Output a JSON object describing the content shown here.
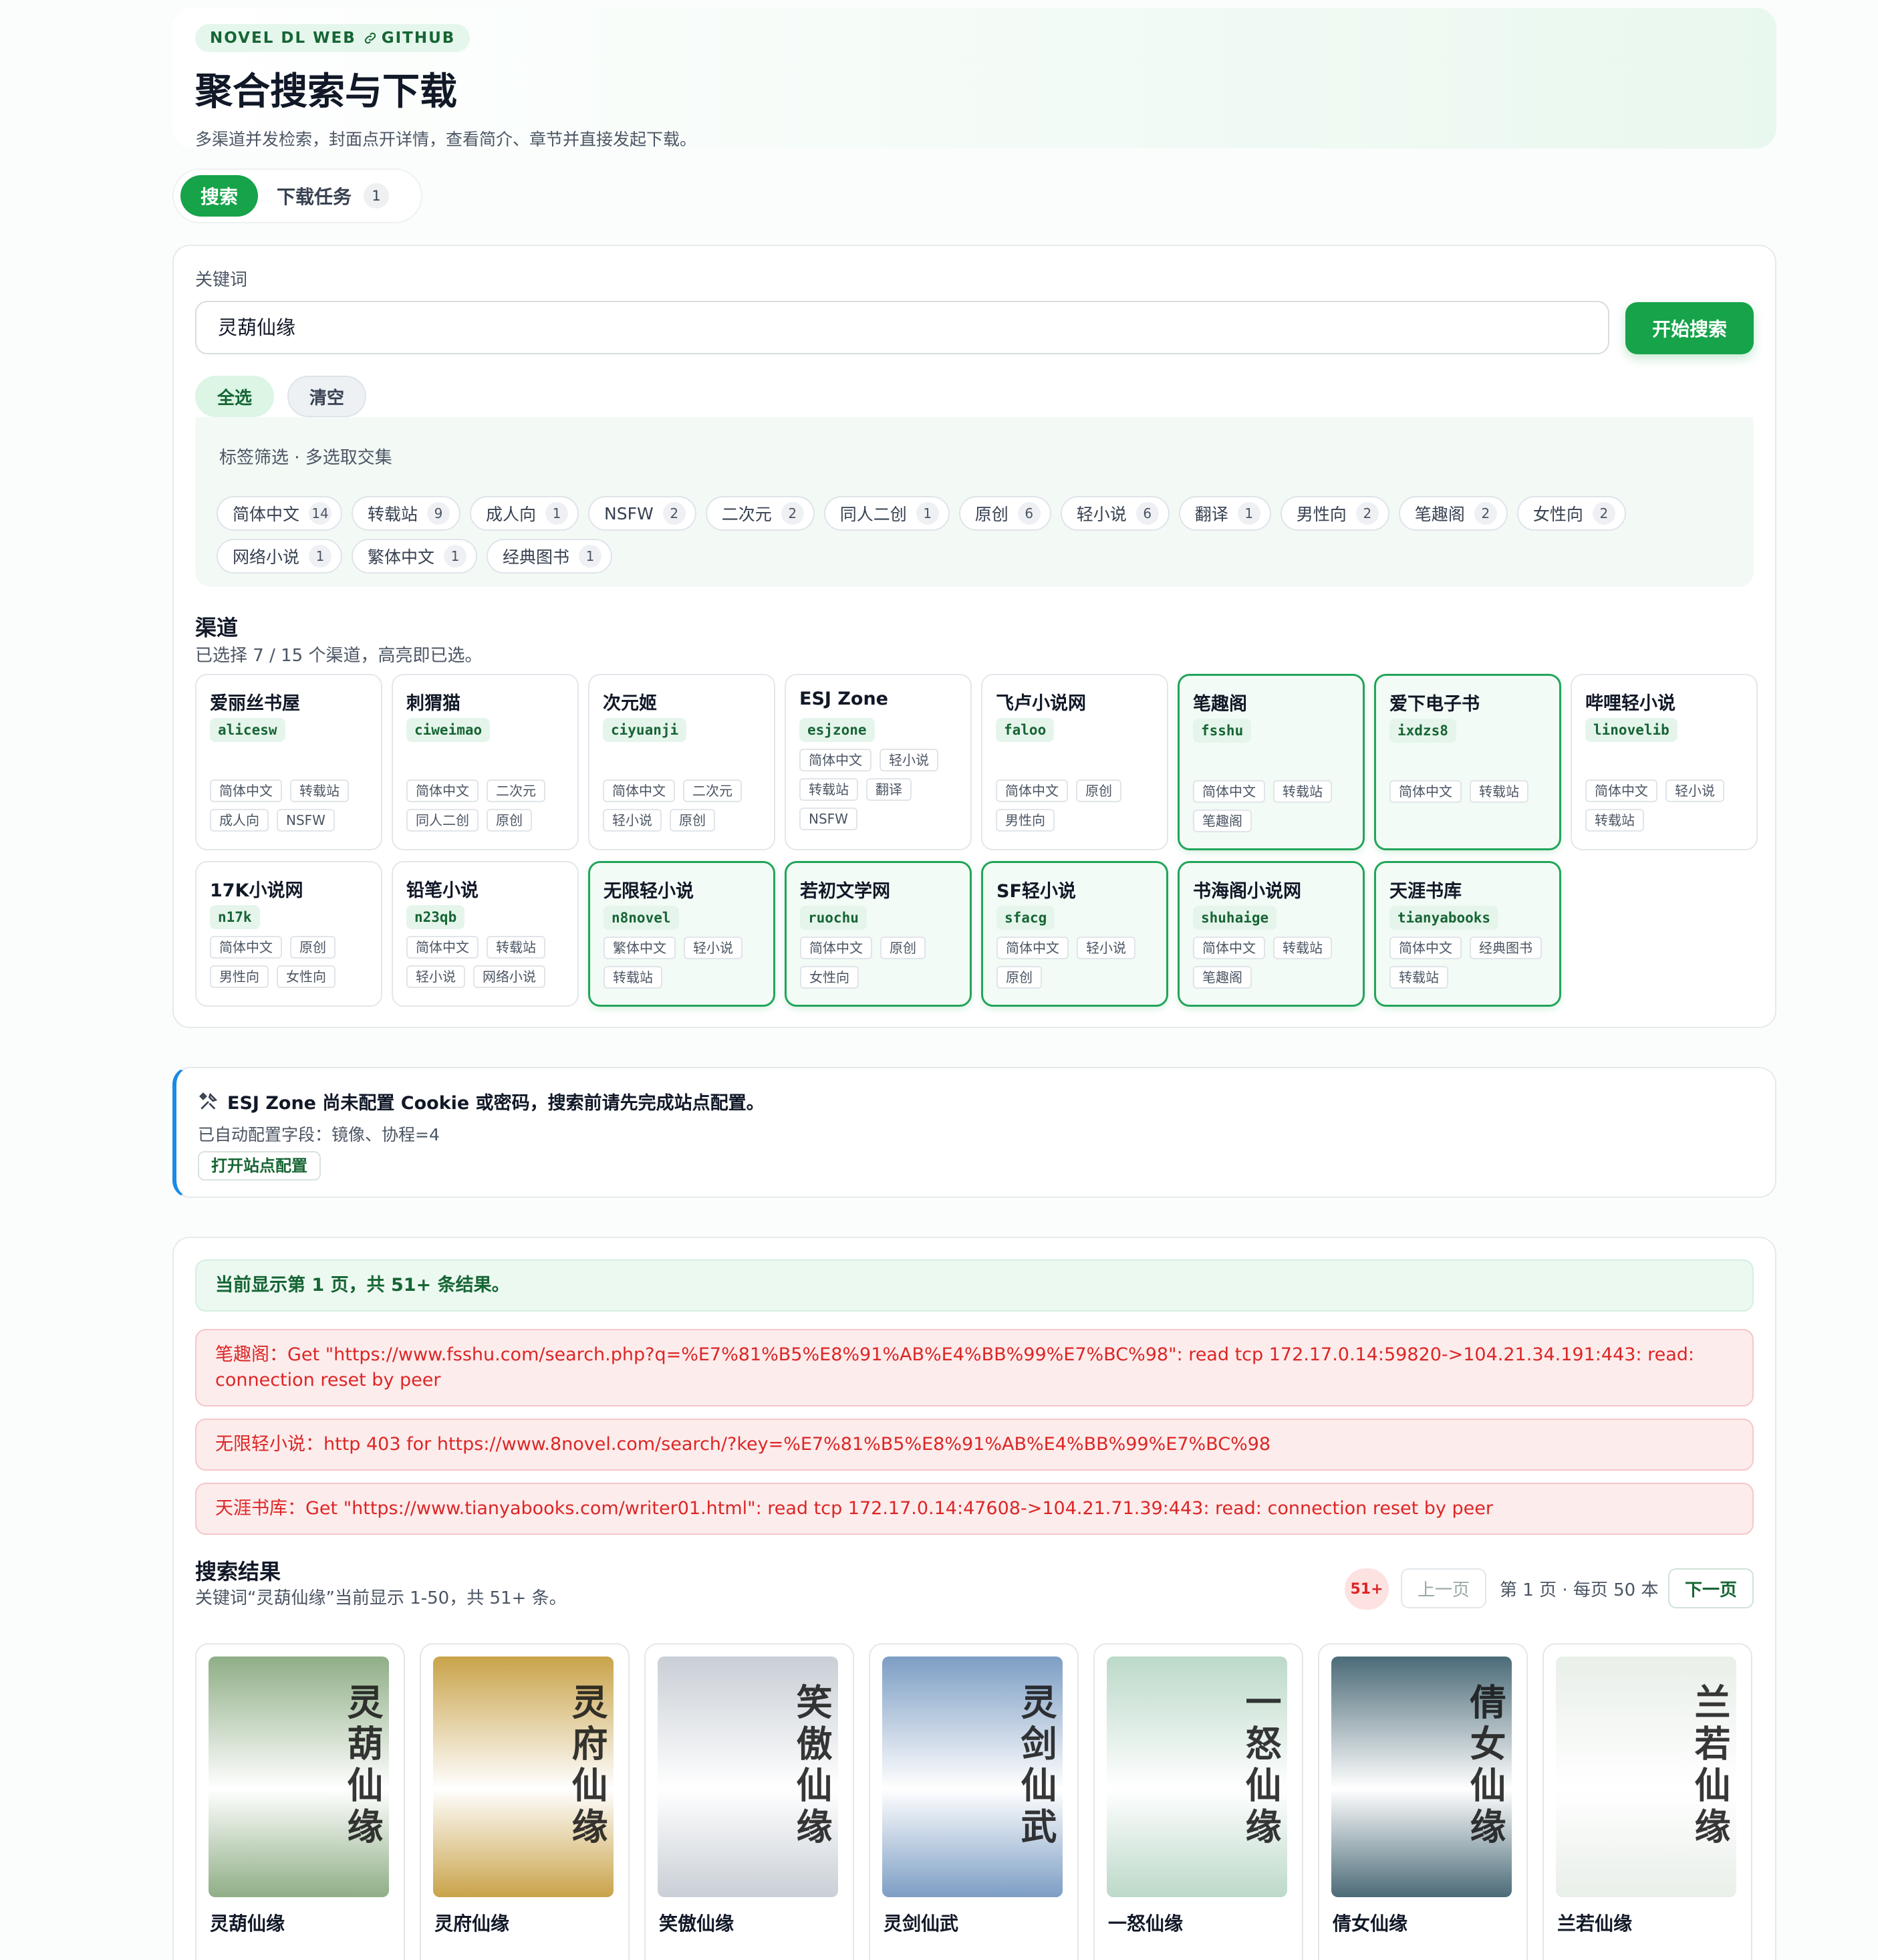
{
  "header": {
    "badge": "NOVEL DL WEB",
    "github_label": "GITHUB",
    "title": "聚合搜索与下载",
    "subtitle": "多渠道并发检索，封面点开详情，查看简介、章节并直接发起下载。"
  },
  "tabs": {
    "search": "搜索",
    "downloads": "下载任务",
    "downloads_count": "1"
  },
  "search": {
    "keyword_label": "关键词",
    "keyword_value": "灵葫仙缘",
    "submit_label": "开始搜索",
    "select_all": "全选",
    "clear": "清空",
    "tag_filter_title": "标签筛选 · 多选取交集",
    "tags": [
      {
        "name": "简体中文",
        "count": "14"
      },
      {
        "name": "转载站",
        "count": "9"
      },
      {
        "name": "成人向",
        "count": "1"
      },
      {
        "name": "NSFW",
        "count": "2"
      },
      {
        "name": "二次元",
        "count": "2"
      },
      {
        "name": "同人二创",
        "count": "1"
      },
      {
        "name": "原创",
        "count": "6"
      },
      {
        "name": "轻小说",
        "count": "6"
      },
      {
        "name": "翻译",
        "count": "1"
      },
      {
        "name": "男性向",
        "count": "2"
      },
      {
        "name": "笔趣阁",
        "count": "2"
      },
      {
        "name": "女性向",
        "count": "2"
      },
      {
        "name": "网络小说",
        "count": "1"
      },
      {
        "name": "繁体中文",
        "count": "1"
      },
      {
        "name": "经典图书",
        "count": "1"
      }
    ]
  },
  "channels": {
    "title": "渠道",
    "summary": "已选择 7 / 15 个渠道，高亮即已选。",
    "items": [
      {
        "name": "爱丽丝书屋",
        "code": "alicesw",
        "selected": false,
        "tags": [
          "简体中文",
          "转载站",
          "成人向",
          "NSFW"
        ]
      },
      {
        "name": "刺猬猫",
        "code": "ciweimao",
        "selected": false,
        "tags": [
          "简体中文",
          "二次元",
          "同人二创",
          "原创"
        ]
      },
      {
        "name": "次元姬",
        "code": "ciyuanji",
        "selected": false,
        "tags": [
          "简体中文",
          "二次元",
          "轻小说",
          "原创"
        ]
      },
      {
        "name": "ESJ Zone",
        "code": "esjzone",
        "selected": false,
        "tags": [
          "简体中文",
          "轻小说",
          "转载站",
          "翻译",
          "NSFW"
        ]
      },
      {
        "name": "飞卢小说网",
        "code": "faloo",
        "selected": false,
        "tags": [
          "简体中文",
          "原创",
          "男性向"
        ]
      },
      {
        "name": "笔趣阁",
        "code": "fsshu",
        "selected": true,
        "tags": [
          "简体中文",
          "转载站",
          "笔趣阁"
        ]
      },
      {
        "name": "爱下电子书",
        "code": "ixdzs8",
        "selected": true,
        "tags": [
          "简体中文",
          "转载站"
        ]
      },
      {
        "name": "哔哩轻小说",
        "code": "linovelib",
        "selected": false,
        "tags": [
          "简体中文",
          "轻小说",
          "转载站"
        ]
      },
      {
        "name": "17K小说网",
        "code": "n17k",
        "selected": false,
        "tags": [
          "简体中文",
          "原创",
          "男性向",
          "女性向"
        ]
      },
      {
        "name": "铅笔小说",
        "code": "n23qb",
        "selected": false,
        "tags": [
          "简体中文",
          "转载站",
          "轻小说",
          "网络小说"
        ]
      },
      {
        "name": "无限轻小说",
        "code": "n8novel",
        "selected": true,
        "tags": [
          "繁体中文",
          "轻小说",
          "转载站"
        ]
      },
      {
        "name": "若初文学网",
        "code": "ruochu",
        "selected": true,
        "tags": [
          "简体中文",
          "原创",
          "女性向"
        ]
      },
      {
        "name": "SF轻小说",
        "code": "sfacg",
        "selected": true,
        "tags": [
          "简体中文",
          "轻小说",
          "原创"
        ]
      },
      {
        "name": "书海阁小说网",
        "code": "shuhaige",
        "selected": true,
        "tags": [
          "简体中文",
          "转载站",
          "笔趣阁"
        ]
      },
      {
        "name": "天涯书库",
        "code": "tianyabooks",
        "selected": true,
        "tags": [
          "简体中文",
          "经典图书",
          "转载站"
        ]
      }
    ]
  },
  "warning": {
    "icon": "tools-icon",
    "title": "ESJ Zone 尚未配置 Cookie 或密码，搜索前请先完成站点配置。",
    "detail": "已自动配置字段：镜像、协程=4",
    "action": "打开站点配置",
    "accent": "#1a8ae5"
  },
  "results": {
    "status": "当前显示第 1 页，共 51+ 条结果。",
    "errors": [
      "笔趣阁：Get \"https://www.fsshu.com/search.php?q=%E7%81%B5%E8%91%AB%E4%BB%99%E7%BC%98\": read tcp 172.17.0.14:59820->104.21.34.191:443: read: connection reset by peer",
      "无限轻小说：http 403 for https://www.8novel.com/search/?key=%E7%81%B5%E8%91%AB%E4%BB%99%E7%BC%98",
      "天涯书库：Get \"https://www.tianyabooks.com/writer01.html\": read tcp 172.17.0.14:47608->104.21.71.39:443: read: connection reset by peer"
    ],
    "title": "搜索结果",
    "summary": "关键词“灵葫仙缘”当前显示 1-50，共 51+ 条。",
    "count_badge": "51+",
    "prev": "上一页",
    "page_info": "第 1 页 · 每页 50 本",
    "next": "下一页",
    "books": [
      {
        "title": "灵葫仙缘",
        "cover_text": "灵葫仙缘",
        "bg": "#8fae86"
      },
      {
        "title": "灵府仙缘",
        "cover_text": "灵府仙缘",
        "bg": "#c9a34a"
      },
      {
        "title": "笑傲仙缘",
        "cover_text": "笑傲仙缘",
        "bg": "#c9cfd6"
      },
      {
        "title": "灵剑仙武",
        "cover_text": "灵剑仙武",
        "bg": "#7d9ec4"
      },
      {
        "title": "一怒仙缘",
        "cover_text": "一怒仙缘",
        "bg": "#bcd9c9"
      },
      {
        "title": "倩女仙缘",
        "cover_text": "倩女仙缘",
        "bg": "#4b6b78"
      },
      {
        "title": "兰若仙缘",
        "cover_text": "兰若仙缘",
        "bg": "#e9efe9"
      }
    ]
  },
  "colors": {
    "brand": "#16a34a",
    "error": "#dc2626"
  }
}
